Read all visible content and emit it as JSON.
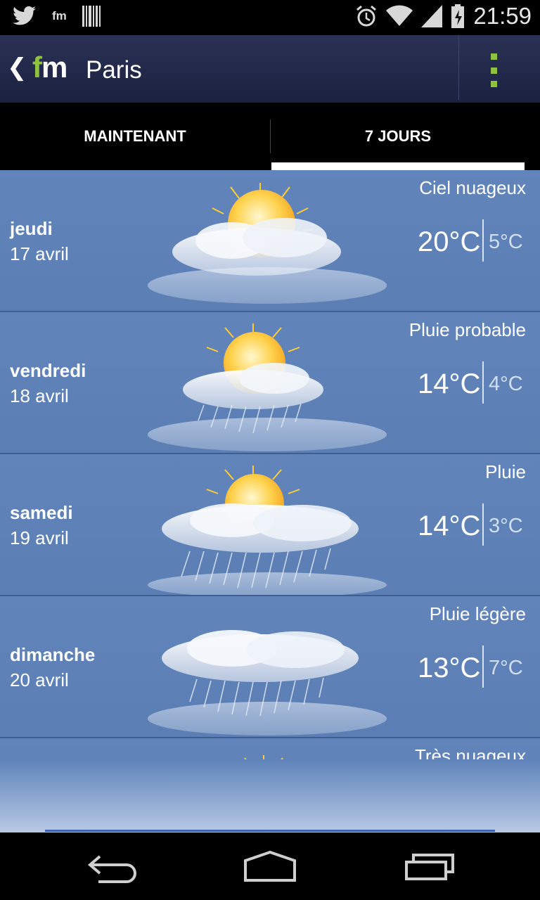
{
  "status_bar": {
    "notification_icons": [
      "twitter-icon",
      "fm-icon",
      "barcode-icon"
    ],
    "fm_label": "fm",
    "system_icons": [
      "alarm-icon",
      "wifi-icon",
      "signal-icon",
      "battery-charging-icon"
    ],
    "time": "21:59"
  },
  "app_bar": {
    "logo_prefix": "f",
    "logo_suffix": "m",
    "city": "Paris",
    "menu_icon": "overflow-menu-icon"
  },
  "tabs": [
    {
      "label": "MAINTENANT",
      "selected": false
    },
    {
      "label": "7 JOURS",
      "selected": true
    }
  ],
  "forecast": [
    {
      "day": "jeudi",
      "date": "17 avril",
      "condition": "Ciel nuageux",
      "high": "20°C",
      "low": "5°C",
      "icon": "sun-cloud-icon"
    },
    {
      "day": "vendredi",
      "date": "18 avril",
      "condition": "Pluie probable",
      "high": "14°C",
      "low": "4°C",
      "icon": "sun-cloud-rain-icon"
    },
    {
      "day": "samedi",
      "date": "19 avril",
      "condition": "Pluie",
      "high": "14°C",
      "low": "3°C",
      "icon": "sun-cloud-heavy-rain-icon"
    },
    {
      "day": "dimanche",
      "date": "20 avril",
      "condition": "Pluie légère",
      "high": "13°C",
      "low": "7°C",
      "icon": "cloud-rain-icon"
    },
    {
      "day": "",
      "date": "",
      "condition": "Très nuageux",
      "high": "",
      "low": "",
      "icon": "sun-cloud-icon"
    }
  ],
  "nav_bar": [
    "back-icon",
    "home-icon",
    "recent-apps-icon"
  ],
  "colors": {
    "accent": "#8fc23f",
    "app_bar": "#232a4a",
    "list_bg": "#5f82b7"
  }
}
